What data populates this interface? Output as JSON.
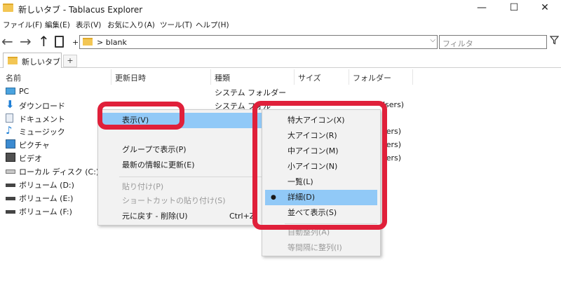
{
  "window": {
    "title": "新しいタブ - Tablacus Explorer",
    "minimize": "—",
    "maximize": "☐",
    "close": "✕"
  },
  "menubar": [
    "ファイル(F)",
    "編集(E)",
    "表示(V)",
    "お気に入り(A)",
    "ツール(T)",
    "ヘルプ(H)"
  ],
  "toolbar": {
    "back": "←",
    "forward": "→",
    "up": "↑",
    "plus": "+",
    "address": "> blank",
    "address_drop": "⌵",
    "filter_placeholder": "フィルタ",
    "filter_icon": "filter-icon"
  },
  "tabs": {
    "active": "新しいタブ",
    "add": "+"
  },
  "columns": [
    "名前",
    "更新日時",
    "種類",
    "サイズ",
    "フォルダー"
  ],
  "items": [
    {
      "name": "PC",
      "icon": "pc-icon"
    },
    {
      "name": "ダウンロード",
      "icon": "download-icon"
    },
    {
      "name": "ドキュメント",
      "icon": "document-icon"
    },
    {
      "name": "ミュージック",
      "icon": "music-icon"
    },
    {
      "name": "ピクチャ",
      "icon": "picture-icon"
    },
    {
      "name": "ビデオ",
      "icon": "video-icon"
    },
    {
      "name": "ローカル ディスク (C:)",
      "icon": "drive-icon"
    },
    {
      "name": "ボリューム (D:)",
      "icon": "drive-icon"
    },
    {
      "name": "ボリューム (E:)",
      "icon": "drive-icon"
    },
    {
      "name": "ボリューム (F:)",
      "icon": "drive-icon"
    }
  ],
  "types": [
    "システム フォルダー",
    "システム フォル"
  ],
  "folder_fragments": [
    "Users)",
    "sers)",
    "sers)",
    "sers)",
    "sers)"
  ],
  "context_menu": {
    "items": [
      {
        "label": "表示(V)",
        "selected": true
      },
      {
        "label": "グループで表示(P)"
      },
      {
        "label": "最新の情報に更新(E)"
      },
      {
        "label": "貼り付け(P)",
        "disabled": true
      },
      {
        "label": "ショートカットの貼り付け(S)",
        "disabled": true
      },
      {
        "label": "元に戻す - 削除(U)",
        "shortcut": "Ctrl+Z"
      }
    ]
  },
  "submenu": {
    "items": [
      {
        "label": "特大アイコン(X)"
      },
      {
        "label": "大アイコン(R)"
      },
      {
        "label": "中アイコン(M)"
      },
      {
        "label": "小アイコン(N)"
      },
      {
        "label": "一覧(L)"
      },
      {
        "label": "詳細(D)",
        "selected": true,
        "bullet": "●"
      },
      {
        "label": "並べて表示(S)"
      },
      {
        "label": "自動整列(A)",
        "disabled": true
      },
      {
        "label": "等間隔に整列(I)",
        "disabled": true
      }
    ]
  },
  "colors": {
    "highlight": "#e0203a",
    "selection": "#91c9f7",
    "folder": "#f3c654"
  }
}
